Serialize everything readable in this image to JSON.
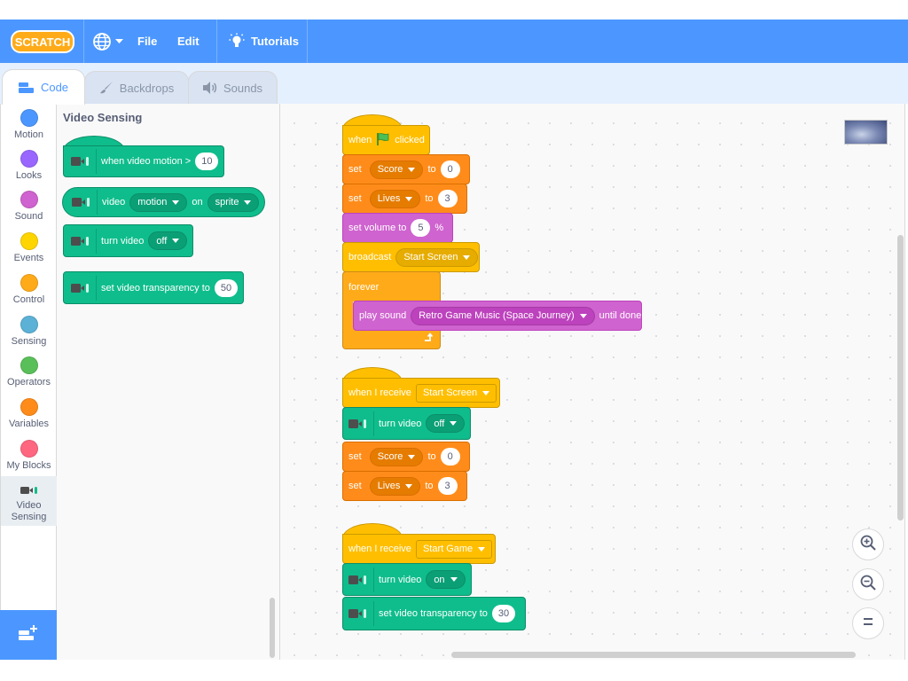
{
  "app": {
    "logo_text": "SCRATCH",
    "brand_color": "#4c97ff"
  },
  "menu": {
    "file_label": "File",
    "edit_label": "Edit",
    "tutorials_label": "Tutorials",
    "language_icon": "globe-icon"
  },
  "tabs": {
    "code_label": "Code",
    "backdrops_label": "Backdrops",
    "sounds_label": "Sounds"
  },
  "categories": [
    {
      "label": "Motion",
      "color": "#4c97ff"
    },
    {
      "label": "Looks",
      "color": "#9966ff"
    },
    {
      "label": "Sound",
      "color": "#cf63cf"
    },
    {
      "label": "Events",
      "color": "#ffd500"
    },
    {
      "label": "Control",
      "color": "#ffab19"
    },
    {
      "label": "Sensing",
      "color": "#5cb1d6"
    },
    {
      "label": "Operators",
      "color": "#59c059"
    },
    {
      "label": "Variables",
      "color": "#ff8c1a"
    },
    {
      "label": "My Blocks",
      "color": "#ff6680"
    },
    {
      "label": "Video Sensing",
      "icon": "video-sensing-icon"
    }
  ],
  "palette": {
    "title": "Video Sensing",
    "blocks": {
      "when_motion": {
        "text": "when video motion >",
        "value": "10"
      },
      "video_of": {
        "text1": "video",
        "dd1": "motion",
        "text2": "on",
        "dd2": "sprite"
      },
      "turn_video": {
        "text": "turn video",
        "dd": "off"
      },
      "set_transparency": {
        "text": "set video transparency to",
        "value": "50"
      }
    }
  },
  "scripts": {
    "s1": {
      "hat": {
        "text1": "when",
        "text2": "clicked"
      },
      "set_score": {
        "text": "set",
        "var": "Score",
        "to": "to",
        "value": "0"
      },
      "set_lives": {
        "text": "set",
        "var": "Lives",
        "to": "to",
        "value": "3"
      },
      "set_volume": {
        "text": "set volume to",
        "value": "5",
        "unit": "%"
      },
      "broadcast": {
        "text": "broadcast",
        "msg": "Start Screen"
      },
      "forever": {
        "text": "forever"
      },
      "play_sound": {
        "text": "play sound",
        "sound": "Retro Game Music (Space Journey)",
        "suffix": "until done"
      }
    },
    "s2": {
      "hat": {
        "text": "when I receive",
        "msg": "Start Screen"
      },
      "turn_video": {
        "text": "turn video",
        "dd": "off"
      },
      "set_score": {
        "text": "set",
        "var": "Score",
        "to": "to",
        "value": "0"
      },
      "set_lives": {
        "text": "set",
        "var": "Lives",
        "to": "to",
        "value": "3"
      }
    },
    "s3": {
      "hat": {
        "text": "when I receive",
        "msg": "Start Game"
      },
      "turn_video": {
        "text": "turn video",
        "dd": "on"
      },
      "set_transparency": {
        "text": "set video transparency to",
        "value": "30"
      }
    }
  }
}
